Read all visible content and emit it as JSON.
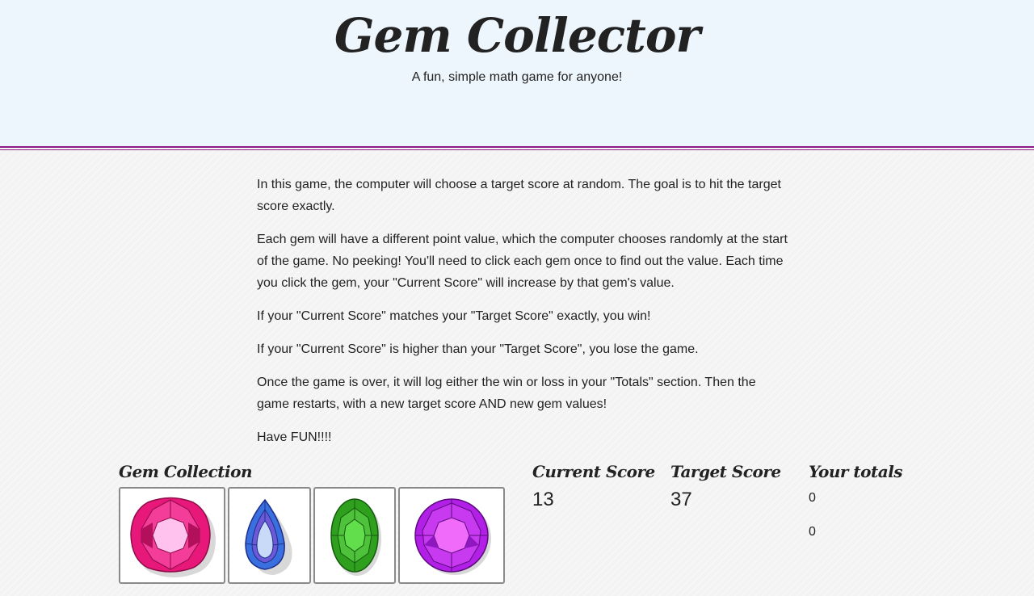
{
  "header": {
    "title": "Gem Collector",
    "subtitle": "A fun, simple math game for anyone!"
  },
  "instructions": [
    "In this game, the computer will choose a target score at random. The goal is to hit the target score exactly.",
    "Each gem will have a different point value, which the computer chooses randomly at the start of the game. No peeking! You'll need to click each gem once to find out the value. Each time you click the gem, your \"Current Score\" will increase by that gem's value.",
    "If your \"Current Score\" matches your \"Target Score\" exactly, you win!",
    "If your \"Current Score\" is higher than your \"Target Score\", you lose the game.",
    "Once the game is over, it will log either the win or loss in your \"Totals\" section. Then the game restarts, with a new target score AND new gem values!",
    "Have FUN!!!!"
  ],
  "gem_collection": {
    "heading": "Gem Collection",
    "gems": [
      {
        "name": "pink cushion gem",
        "color": "#e8177a"
      },
      {
        "name": "blue teardrop gem",
        "color": "#3a6fe0"
      },
      {
        "name": "green oval gem",
        "color": "#2ea01e"
      },
      {
        "name": "purple round gem",
        "color": "#b21fe6"
      }
    ]
  },
  "current_score": {
    "heading": "Current Score",
    "value": "13"
  },
  "target_score": {
    "heading": "Target Score",
    "value": "37"
  },
  "totals": {
    "heading": "Your totals",
    "wins": "0",
    "losses": "0"
  },
  "colors": {
    "header_bg": "#eef6fd",
    "rule": "#8b1a82",
    "page_bg": "#f3f3f3"
  }
}
